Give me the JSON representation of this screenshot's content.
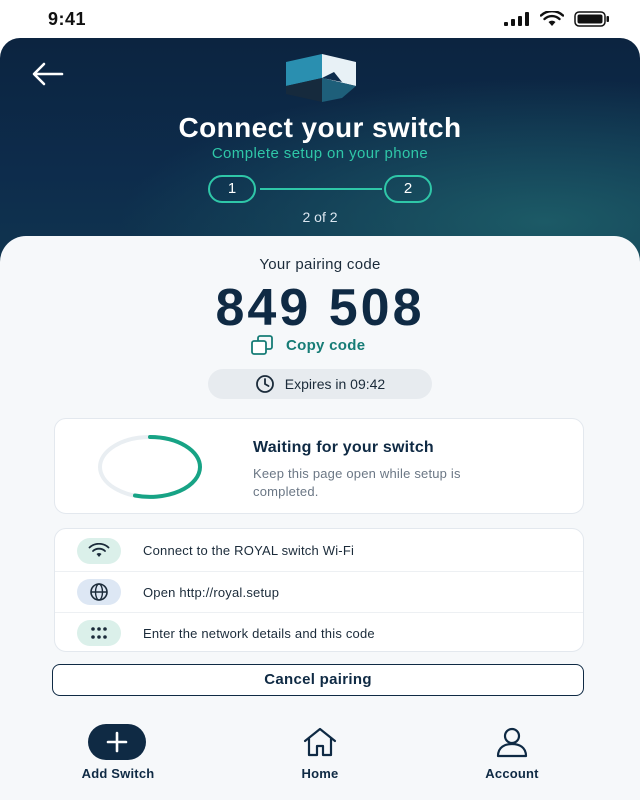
{
  "status_bar": {
    "time": "9:41"
  },
  "header": {
    "title": "Connect your switch",
    "subtitle": "Complete setup on your phone",
    "steps": [
      "1",
      "2"
    ],
    "step_counter": "2 of 2"
  },
  "pairing": {
    "label": "Your pairing code",
    "code": "849 508",
    "copy_label": "Copy code",
    "expiry": "Expires in 09:42"
  },
  "waiting": {
    "title": "Waiting for your switch",
    "description": "Keep this page open while setup is completed."
  },
  "instructions": [
    {
      "icon": "wifi-icon",
      "text": "Connect to the ROYAL switch Wi-Fi"
    },
    {
      "icon": "globe-icon",
      "text": "Open http://royal.setup"
    },
    {
      "icon": "keypad-icon",
      "text": "Enter the network details and this code"
    }
  ],
  "cancel_label": "Cancel pairing",
  "nav": [
    {
      "icon": "plus-icon",
      "label": "Add Switch"
    },
    {
      "icon": "home-icon",
      "label": "Home"
    },
    {
      "icon": "user-icon",
      "label": "Account"
    }
  ],
  "colors": {
    "accent": "#2fc7a8",
    "navy": "#0f2a44",
    "link": "#167c76"
  }
}
